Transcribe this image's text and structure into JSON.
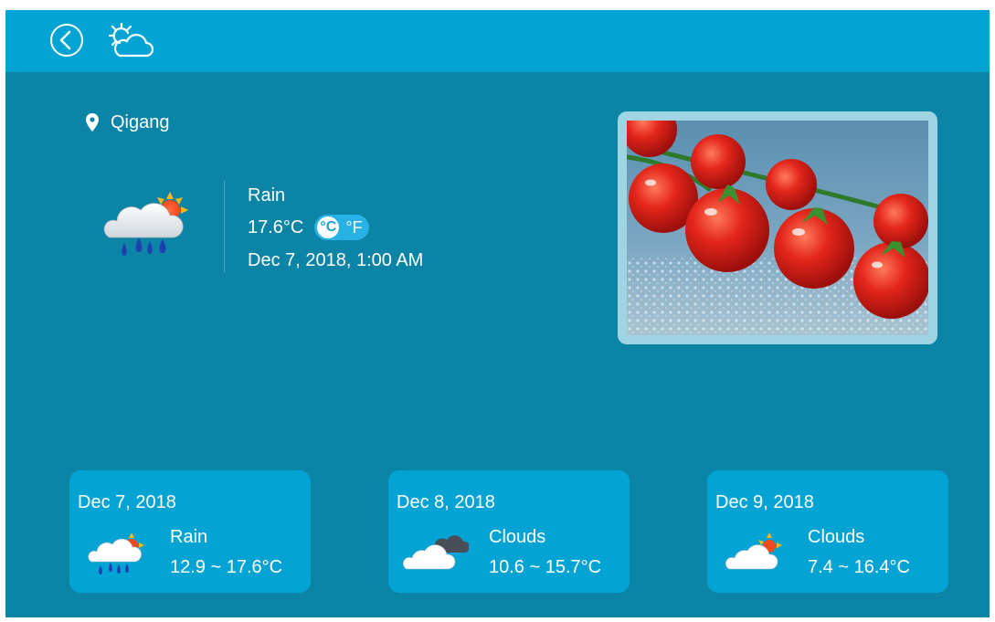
{
  "topbar": {
    "back_icon": "chevron-left-circle-icon",
    "app_icon": "sun-behind-cloud-outline-icon"
  },
  "current": {
    "location": "Qigang",
    "condition": "Rain",
    "temperature": "17.6°C",
    "unit_celsius": "°C",
    "unit_fahrenheit": "°F",
    "selected_unit": "°C",
    "datetime": "Dec 7, 2018, 1:00 AM",
    "icon": "rain-cloud-sun-icon"
  },
  "photo": {
    "subject": "tomatoes-photo"
  },
  "forecast": [
    {
      "date": "Dec 7, 2018",
      "condition": "Rain",
      "range": "12.9 ~ 17.6°C",
      "icon": "rain-cloud-sun-icon"
    },
    {
      "date": "Dec 8, 2018",
      "condition": "Clouds",
      "range": "10.6 ~ 15.7°C",
      "icon": "clouds-icon"
    },
    {
      "date": "Dec 9, 2018",
      "condition": "Clouds",
      "range": "7.4 ~ 16.4°C",
      "icon": "cloud-sun-icon"
    }
  ],
  "colors": {
    "background": "#0b84a6",
    "topbar": "#03a4d4",
    "card": "#03a4d4",
    "text": "#ffffff"
  }
}
